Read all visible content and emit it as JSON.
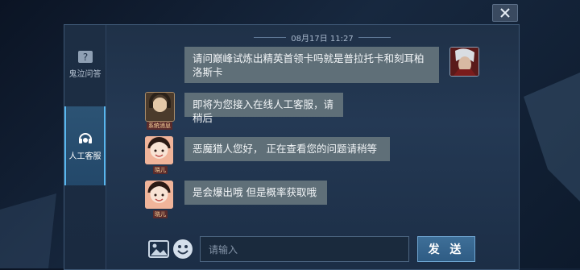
{
  "sidebar": {
    "items": [
      {
        "label": "鬼泣问答",
        "icon": "question-book-icon",
        "active": false
      },
      {
        "label": "人工客服",
        "icon": "headset-icon",
        "active": true
      }
    ]
  },
  "chat": {
    "timestamp": "08月17日 11:27",
    "messages": [
      {
        "side": "right",
        "text": "请问巅峰试炼出精英首领卡吗就是普拉托卡和刻耳柏洛斯卡",
        "avatar": "dante-avatar"
      },
      {
        "side": "left",
        "text": "即将为您接入在线人工客服，请稍后",
        "avatar": "system-avatar",
        "badge": "系统消息"
      },
      {
        "side": "left",
        "text": "恶魔猎人您好， 正在查看您的问题请稍等",
        "avatar": "agent-avatar",
        "badge": "晓儿"
      },
      {
        "side": "left",
        "text": "是会爆出哦 但是概率获取哦",
        "avatar": "agent-avatar",
        "badge": "晓儿"
      }
    ]
  },
  "input": {
    "placeholder": "请输入",
    "send_label": "发 送"
  },
  "colors": {
    "accent": "#58b6ee",
    "bubble": "#5f6f78",
    "dialog_bg": "#243954"
  }
}
